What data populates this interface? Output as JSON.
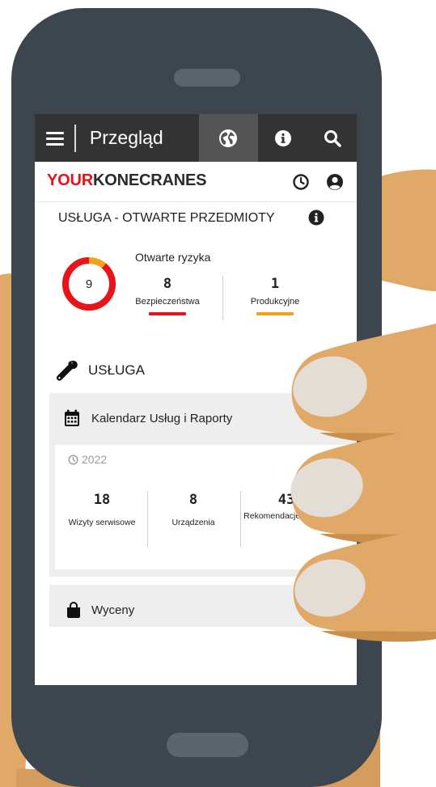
{
  "topbar": {
    "title": "Przegląd",
    "icons": [
      "menu-icon",
      "globe-icon",
      "info-icon",
      "search-icon"
    ]
  },
  "brand": {
    "part1": "YOUR",
    "part2": "KONECRANES",
    "accent_color": "#e4131c"
  },
  "open_items": {
    "heading": "USŁUGA - OTWARTE PRZEDMIOTY",
    "total": "9",
    "risks_title": "Otwarte ryzyka",
    "safety": {
      "count": "8",
      "label": "Bezpieczeństwa",
      "color": "#e8141c"
    },
    "production": {
      "count": "1",
      "label": "Produkcyjne",
      "color": "#f5a01a"
    },
    "safety_fraction": 0.889
  },
  "service": {
    "heading": "USŁUGA",
    "calendar": {
      "title": "Kalendarz Usług i Raporty",
      "year": "2022",
      "stats": [
        {
          "num": "18",
          "label": "Wizyty serwisowe"
        },
        {
          "num": "8",
          "label": "Urządzenia"
        },
        {
          "num": "43",
          "label": "Rekomendacje łącznie"
        }
      ]
    },
    "quotes": {
      "title": "Wyceny"
    }
  },
  "colors": {
    "phone": "#3d454e",
    "topbar": "#333333",
    "hand": "#e0a968",
    "nail": "#e4ddd6"
  }
}
